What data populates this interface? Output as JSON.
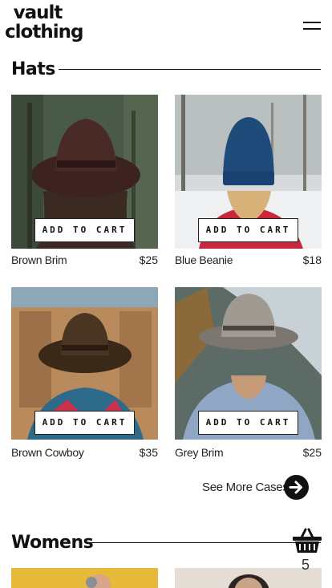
{
  "brand": {
    "line1": "vault",
    "line2": "clothing"
  },
  "sections": {
    "hats": {
      "title": "Hats"
    },
    "womens": {
      "title": "Womens"
    }
  },
  "products": [
    {
      "name": "Brown Brim",
      "price": "$25",
      "cta": "ADD TO CART"
    },
    {
      "name": "Blue Beanie",
      "price": "$18",
      "cta": "ADD TO CART"
    },
    {
      "name": "Brown Cowboy",
      "price": "$35",
      "cta": "ADD TO CART"
    },
    {
      "name": "Grey Brim",
      "price": "$25",
      "cta": "ADD TO CART"
    }
  ],
  "see_more": {
    "label": "See More Cases"
  },
  "cart": {
    "count": "5"
  },
  "icons": {
    "menu": "hamburger-icon",
    "arrow": "arrow-right-icon",
    "basket": "shopping-basket-icon"
  }
}
